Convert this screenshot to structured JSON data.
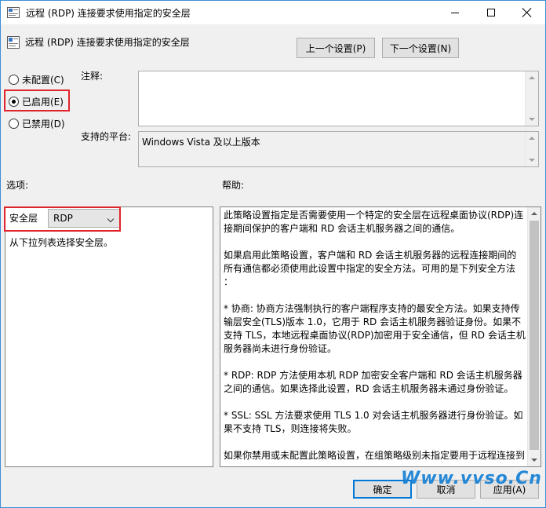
{
  "window": {
    "title": "远程 (RDP) 连接要求使用指定的安全层"
  },
  "header": {
    "policy_name": "远程 (RDP) 连接要求使用指定的安全层",
    "prev_button": "上一个设置(P)",
    "next_button": "下一个设置(N)"
  },
  "state": {
    "options": [
      {
        "label": "未配置(C)",
        "selected": false
      },
      {
        "label": "已启用(E)",
        "selected": true
      },
      {
        "label": "已禁用(D)",
        "selected": false
      }
    ]
  },
  "comment": {
    "label": "注释:",
    "value": ""
  },
  "platform": {
    "label": "支持的平台:",
    "value": "Windows Vista 及以上版本"
  },
  "options_section": {
    "label": "选项:",
    "security_layer_label": "安全层",
    "security_layer_value": "RDP",
    "hint": "从下拉列表选择安全层。"
  },
  "help_section": {
    "label": "帮助:",
    "lines": [
      "此策略设置指定是否需要使用一个特定的安全层在远程桌面协议(RDP)连",
      "接期间保护的客户端和 RD 会话主机服务器之间的通信。",
      "",
      "如果启用此策略设置，客户端和 RD 会话主机服务器的远程连接期间的",
      "所有通信都必须使用此设置中指定的安全方法。可用的是下列安全方法",
      "：",
      "",
      " * 协商: 协商方法强制执行的客户端程序支持的最安全方法。如果支持传",
      "输层安全(TLS)版本 1.0，它用于 RD 会话主机服务器验证身份。如果不",
      "支持 TLS，本地远程桌面协议(RDP)加密用于安全通信，但 RD 会话主机",
      "服务器尚未进行身份验证。",
      "",
      " * RDP: RDP 方法使用本机 RDP 加密安全客户端和 RD 会话主机服务器",
      "之间的通信。如果选择此设置，RD 会话主机服务器未通过身份验证。",
      "",
      " * SSL: SSL 方法要求使用 TLS 1.0 对会话主机服务器进行身份验证。如",
      "果不支持 TLS，则连接将失败。",
      "",
      "如果你禁用或未配置此策略设置，在组策略级别未指定要用于远程连接到"
    ]
  },
  "footer": {
    "ok": "确定",
    "cancel": "取消",
    "apply": "应用(A)"
  },
  "watermark": "Www.vvso.Cn"
}
